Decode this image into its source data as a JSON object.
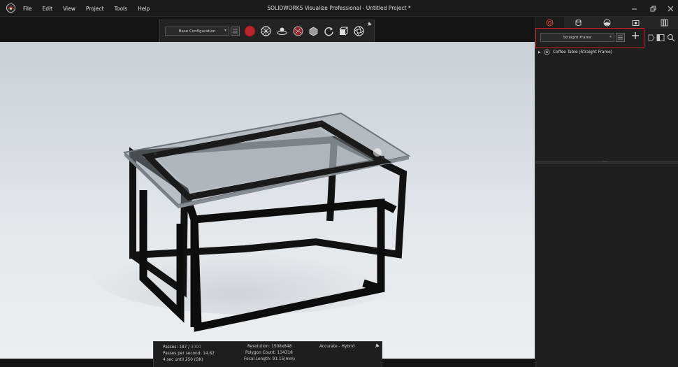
{
  "window": {
    "title": "SOLIDWORKS Visualize Professional - Untitled Project *",
    "controls": [
      "minimize",
      "restore",
      "close"
    ]
  },
  "menu": {
    "items": [
      "File",
      "Edit",
      "View",
      "Project",
      "Tools",
      "Help"
    ]
  },
  "viewport_toolbar": {
    "configuration": "Base Configuration",
    "tools": [
      "render-mode-icon",
      "appearance-icon",
      "lighting-icon",
      "material-icon",
      "object-icon",
      "rotate-icon",
      "camera-icon",
      "aperture-icon"
    ]
  },
  "status": {
    "passes_label": "Passes: 187 / ",
    "passes_total": "3000",
    "passes_per_second": "Passes per second: 14.82",
    "time_left": "4 sec until 250 (OK)",
    "resolution": "Resolution: 1508x848",
    "polygon_count": "Polygon Count: 134318",
    "focal_length": "Focal Length: 91.15(mm)",
    "render_mode": "Accurate - Hybrid"
  },
  "panel": {
    "tabs": [
      "models-tab",
      "appearances-tab",
      "scenes-tab",
      "cameras-tab",
      "libraries-tab"
    ],
    "active_tab": 0,
    "frame_select": "Straight Frame",
    "tree": [
      {
        "label": "Coffee Table (Straight Frame)"
      }
    ]
  },
  "colors": {
    "highlight": "#d02020",
    "render_button": "#b8252a"
  }
}
